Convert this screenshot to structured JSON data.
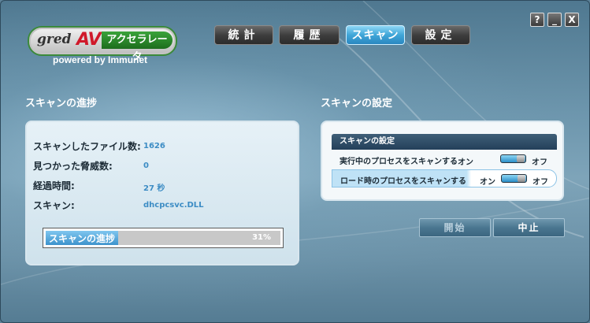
{
  "logo": {
    "gred": "gred",
    "av": "AV",
    "accel": "アクセラレータ",
    "powered": "powered by Immunet"
  },
  "tabs": [
    {
      "label": "統計",
      "active": false
    },
    {
      "label": "履歴",
      "active": false
    },
    {
      "label": "スキャン",
      "active": true
    },
    {
      "label": "設定",
      "active": false
    }
  ],
  "window_controls": {
    "help": "?",
    "minimize": "_",
    "close": "X"
  },
  "progress": {
    "title": "スキャンの進捗",
    "stats": [
      {
        "label": "スキャンしたファイル数:",
        "value": "1626"
      },
      {
        "label": "見つかった脅威数:",
        "value": "0"
      },
      {
        "label": "経過時間:",
        "value": "27 秒"
      },
      {
        "label": "スキャン:",
        "value": "dhcpcsvc.DLL"
      }
    ],
    "bar": {
      "label": "スキャンの進捗",
      "percent_text": "31%",
      "percent": 31
    }
  },
  "settings": {
    "title": "スキャンの設定",
    "header": "スキャンの設定",
    "rows": [
      {
        "label": "実行中のプロセスをスキャンする",
        "on": "オン",
        "off": "オフ",
        "state": "on"
      },
      {
        "label": "ロード時のプロセスをスキャンする",
        "on": "オン",
        "off": "オフ",
        "state": "on"
      }
    ]
  },
  "actions": {
    "start": "開始",
    "stop": "中止"
  },
  "colors": {
    "accent": "#3fa6d8",
    "value_text": "#3c8cc4",
    "header_dark": "#24405a"
  }
}
